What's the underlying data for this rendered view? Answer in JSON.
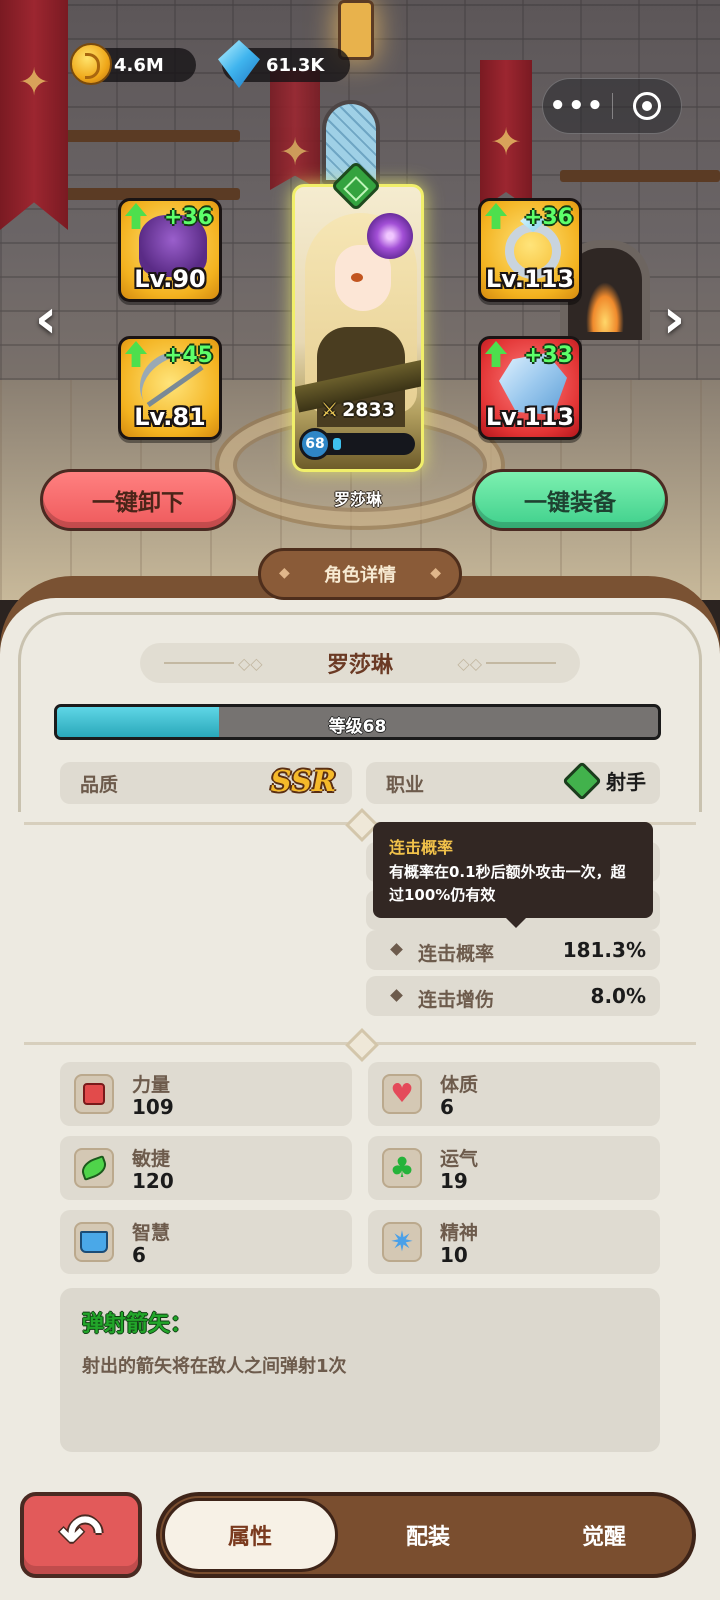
{
  "resources": {
    "gold": "4.6M",
    "gems": "61.3K"
  },
  "equipment": [
    {
      "slot": "helmet",
      "level": "Lv.90",
      "bonus": "+36",
      "rarity_color": "#f3b21f"
    },
    {
      "slot": "ring",
      "level": "Lv.113",
      "bonus": "+36",
      "rarity_color": "#f3b21f"
    },
    {
      "slot": "bow",
      "level": "Lv.81",
      "bonus": "+45",
      "rarity_color": "#f3b21f"
    },
    {
      "slot": "crystal",
      "level": "Lv.113",
      "bonus": "+33",
      "rarity_color": "#e23434"
    }
  ],
  "hero": {
    "name": "罗莎琳",
    "power": "2833",
    "level": "68",
    "level_progress": 0.05
  },
  "actions": {
    "unequip_all": "一键卸下",
    "equip_all": "一键装备"
  },
  "panel": {
    "title": "角色详情",
    "hero_name": "罗莎琳",
    "exp_label": "等级68",
    "exp_progress": 0.27,
    "quality_label": "品质",
    "quality_value": "SSR",
    "job_label": "职业",
    "job_value": "射手",
    "tooltip": {
      "title": "连击概率",
      "desc": "有概率在0.1秒后额外攻击一次，超过100%仍有效"
    },
    "stats": [
      {
        "name": "连击概率",
        "value": "181.3%"
      },
      {
        "name": "连击增伤",
        "value": "8.0%"
      }
    ],
    "attributes": [
      {
        "name": "力量",
        "value": "109",
        "icon": "fist-icon"
      },
      {
        "name": "体质",
        "value": "6",
        "icon": "heart-icon"
      },
      {
        "name": "敏捷",
        "value": "120",
        "icon": "wing-icon"
      },
      {
        "name": "运气",
        "value": "19",
        "icon": "clover-icon"
      },
      {
        "name": "智慧",
        "value": "6",
        "icon": "book-icon"
      },
      {
        "name": "精神",
        "value": "10",
        "icon": "spirit-icon"
      }
    ],
    "skill": {
      "title": "弹射箭矢：",
      "desc": "射出的箭矢将在敌人之间弹射1次"
    }
  },
  "tabs": [
    "属性",
    "配装",
    "觉醒"
  ],
  "colors": {
    "gold_rarity": "#f3b21f",
    "red_rarity": "#e23434",
    "exp": "#2aa8ba",
    "panel": "#edeae1"
  }
}
